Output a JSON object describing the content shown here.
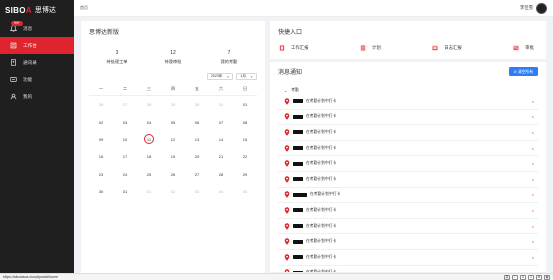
{
  "brand": {
    "logo_latin_a": "SIBO",
    "logo_latin_b": "A",
    "logo_cn": "思博达"
  },
  "sidebar": {
    "items": [
      {
        "label": "消息",
        "icon": "bell-icon",
        "badge": "99+"
      },
      {
        "label": "工作台",
        "icon": "home-icon",
        "active": true
      },
      {
        "label": "通讯录",
        "icon": "contacts-icon"
      },
      {
        "label": "功能",
        "icon": "apps-icon"
      },
      {
        "label": "我的",
        "icon": "user-icon"
      }
    ]
  },
  "header": {
    "breadcrumb": "首页",
    "user_name": "李佳雪"
  },
  "welcome": {
    "title": "思博达新版",
    "stats": [
      {
        "num": "3",
        "label": "待处理工单"
      },
      {
        "num": "12",
        "label": "待我审批"
      },
      {
        "num": "7",
        "label": "我的考勤"
      }
    ]
  },
  "calendar": {
    "year": "2023年",
    "month": "1月",
    "weekdays": [
      "一",
      "二",
      "三",
      "四",
      "五",
      "六",
      "日"
    ],
    "weeks": [
      [
        {
          "d": "26",
          "m": true
        },
        {
          "d": "27",
          "m": true
        },
        {
          "d": "28",
          "m": true
        },
        {
          "d": "29",
          "m": true
        },
        {
          "d": "30",
          "m": true
        },
        {
          "d": "31",
          "m": true
        },
        {
          "d": "01"
        }
      ],
      [
        {
          "d": "02"
        },
        {
          "d": "03"
        },
        {
          "d": "04"
        },
        {
          "d": "05"
        },
        {
          "d": "06"
        },
        {
          "d": "07"
        },
        {
          "d": "08"
        }
      ],
      [
        {
          "d": "09"
        },
        {
          "d": "10"
        },
        {
          "d": "11",
          "today": true
        },
        {
          "d": "12"
        },
        {
          "d": "13"
        },
        {
          "d": "14"
        },
        {
          "d": "15"
        }
      ],
      [
        {
          "d": "16"
        },
        {
          "d": "17"
        },
        {
          "d": "18"
        },
        {
          "d": "19"
        },
        {
          "d": "20"
        },
        {
          "d": "21"
        },
        {
          "d": "22"
        }
      ],
      [
        {
          "d": "23"
        },
        {
          "d": "24"
        },
        {
          "d": "25"
        },
        {
          "d": "26"
        },
        {
          "d": "27"
        },
        {
          "d": "28"
        },
        {
          "d": "29"
        }
      ],
      [
        {
          "d": "30"
        },
        {
          "d": "31"
        },
        {
          "d": "01",
          "m": true
        },
        {
          "d": "02",
          "m": true
        },
        {
          "d": "03",
          "m": true
        },
        {
          "d": "04",
          "m": true
        },
        {
          "d": "05",
          "m": true
        }
      ]
    ]
  },
  "quick": {
    "title": "快捷入口",
    "items": [
      {
        "label": "工作汇报",
        "icon": "report-icon"
      },
      {
        "label": "计划",
        "icon": "plan-icon"
      },
      {
        "label": "日志汇报",
        "icon": "log-icon"
      },
      {
        "label": "审批",
        "icon": "approve-icon"
      }
    ]
  },
  "notice": {
    "title": "消息通知",
    "button": "清空所有",
    "group": "考勤",
    "items": [
      {
        "text": "在考勤计划中打卡",
        "redact": 10
      },
      {
        "text": "在考勤计划中打卡",
        "redact": 10
      },
      {
        "text": "在考勤计划中打卡",
        "redact": 10
      },
      {
        "text": "在考勤计划中打卡",
        "redact": 10
      },
      {
        "text": "在考勤计划中打卡",
        "redact": 10
      },
      {
        "text": "在考勤计划中打卡",
        "redact": 10
      },
      {
        "text": "在考勤计划中打卡",
        "redact": 14
      },
      {
        "text": "在考勤计划中打卡",
        "redact": 10
      },
      {
        "text": "在考勤计划中打卡",
        "redact": 10
      },
      {
        "text": "在考勤计划中打卡",
        "redact": 10
      },
      {
        "text": "在考勤计划中打卡",
        "redact": 10
      },
      {
        "text": "在考勤计划中打卡",
        "redact": 10
      }
    ]
  },
  "statusbar": {
    "url": "https://sibodaoa.cloud/portal/home"
  },
  "colors": {
    "accent": "#e0242f",
    "primary": "#2f7df6",
    "sidebar": "#1f1f1f"
  }
}
